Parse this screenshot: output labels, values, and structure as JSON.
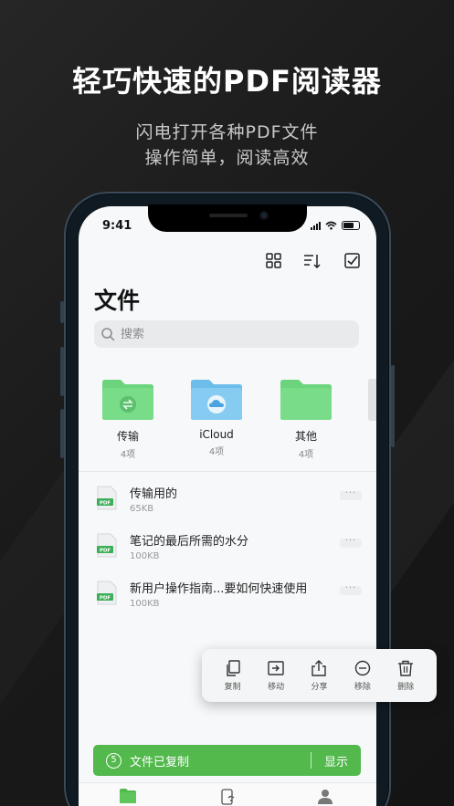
{
  "promo": {
    "title": "轻巧快速的PDF阅读器",
    "subtitle_line1": "闪电打开各种PDF文件",
    "subtitle_line2": "操作简单，阅读高效"
  },
  "status_bar": {
    "time": "9:41"
  },
  "toolbar": {
    "icons": [
      "grid-view-icon",
      "sort-icon",
      "select-checkbox-icon"
    ]
  },
  "page": {
    "title": "文件"
  },
  "search": {
    "placeholder": "搜索",
    "value": ""
  },
  "folders": [
    {
      "name": "传输",
      "count": "4项",
      "color": "#6dd47e",
      "icon": "transfer-icon"
    },
    {
      "name": "iCloud",
      "count": "4项",
      "color": "#7ec8f0",
      "icon": "cloud-icon"
    },
    {
      "name": "其他",
      "count": "4项",
      "color": "#6dd47e",
      "icon": "folder-icon"
    }
  ],
  "files": [
    {
      "name": "传输用的",
      "size": "65KB",
      "badge": "PDF"
    },
    {
      "name": "笔记的最后所需的水分",
      "size": "100KB",
      "badge": "PDF"
    },
    {
      "name": "新用户操作指南...要如何快速使用",
      "size": "100KB",
      "badge": "PDF"
    }
  ],
  "actions": [
    {
      "label": "复制",
      "icon": "copy-icon"
    },
    {
      "label": "移动",
      "icon": "move-icon"
    },
    {
      "label": "分享",
      "icon": "share-icon"
    },
    {
      "label": "移除",
      "icon": "remove-icon"
    },
    {
      "label": "删除",
      "icon": "trash-icon"
    }
  ],
  "toast": {
    "count": "5",
    "message": "文件已复制",
    "action": "显示",
    "color": "#53b94d"
  },
  "tabbar": {
    "icons": [
      "files-tab-icon",
      "wifi-transfer-tab-icon",
      "profile-tab-icon"
    ],
    "active_color": "#53b94d"
  }
}
